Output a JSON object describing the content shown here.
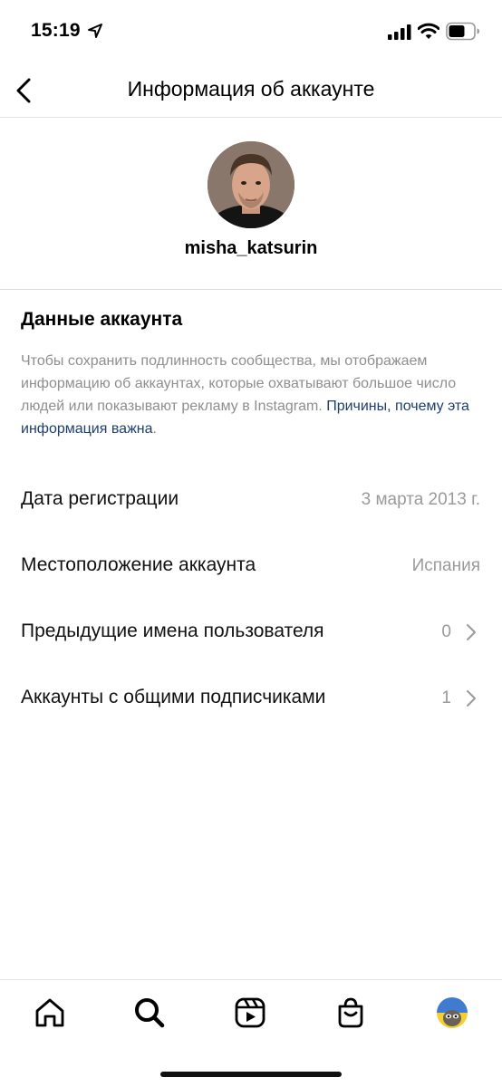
{
  "status_bar": {
    "time": "15:19"
  },
  "header": {
    "title": "Информация об аккаунте"
  },
  "profile": {
    "username": "misha_katsurin"
  },
  "account_data": {
    "title": "Данные аккаунта",
    "description": "Чтобы сохранить подлинность сообщества, мы отображаем информацию об аккаунтах, которые охватывают большое число людей или показывают рекламу в Instagram.",
    "link": "Причины, почему эта информация важна",
    "link_suffix": "."
  },
  "rows": [
    {
      "label": "Дата регистрации",
      "value": "3 марта 2013 г."
    },
    {
      "label": "Местоположение аккаунта",
      "value": "Испания"
    },
    {
      "label": "Предыдущие имена пользователя",
      "value": "0"
    },
    {
      "label": "Аккаунты с общими подписчиками",
      "value": "1"
    }
  ],
  "tabbar": {
    "icons": [
      "home-icon",
      "search-icon",
      "reels-icon",
      "shop-icon",
      "profile-avatar"
    ]
  },
  "colors": {
    "link": "#1c3f6e",
    "muted": "#8e8e8e",
    "divider": "#dbdbdb"
  }
}
